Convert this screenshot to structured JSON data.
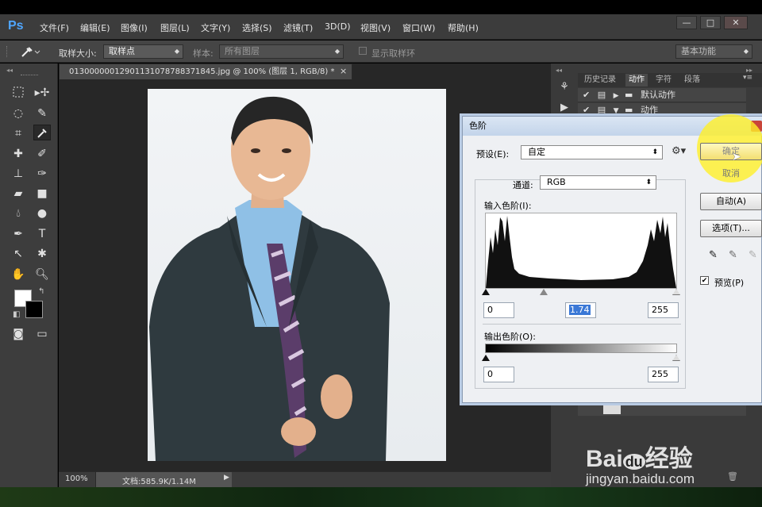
{
  "app": {
    "logo": "Ps"
  },
  "menu": [
    "文件(F)",
    "编辑(E)",
    "图像(I)",
    "图层(L)",
    "文字(Y)",
    "选择(S)",
    "滤镜(T)",
    "3D(D)",
    "视图(V)",
    "窗口(W)",
    "帮助(H)"
  ],
  "window_buttons": {
    "minimize": "—",
    "maximize": "□",
    "close": "✕"
  },
  "options": {
    "sample_size_label": "取样大小:",
    "sample_size_value": "取样点",
    "sample_label": "样本:",
    "sample_value": "所有图层",
    "show_ring_label": "显示取样环",
    "workspace": "基本功能"
  },
  "document": {
    "tab_title": "013000000129011310787883718​45.jpg @ 100% (图层 1, RGB/8) *",
    "tab_close": "×",
    "zoom": "100%",
    "doc_size": "文档:585.9K/1.14M"
  },
  "panels": {
    "tabs": [
      "历史记录",
      "动作",
      "字符",
      "段落"
    ],
    "active_tab": "动作",
    "actions": [
      "默认动作",
      "动作"
    ]
  },
  "levels_dialog": {
    "title": "色阶",
    "preset_label": "预设(E):",
    "preset_value": "自定",
    "channel_label": "通道:",
    "channel_value": "RGB",
    "input_label": "输入色阶(I):",
    "input_black": "0",
    "input_gamma": "1.74",
    "input_white": "255",
    "output_label": "输出色阶(O):",
    "output_black": "0",
    "output_white": "255",
    "buttons": {
      "ok": "确定",
      "cancel": "取消",
      "auto": "自动(A)",
      "options": "选项(T)..."
    },
    "preview_label": "预览(P)",
    "preview_checked": true
  },
  "watermark": {
    "brand": "Bai",
    "brand_paw": "du",
    "brand_cn": "经验",
    "url": "jingyan.baidu.com"
  }
}
